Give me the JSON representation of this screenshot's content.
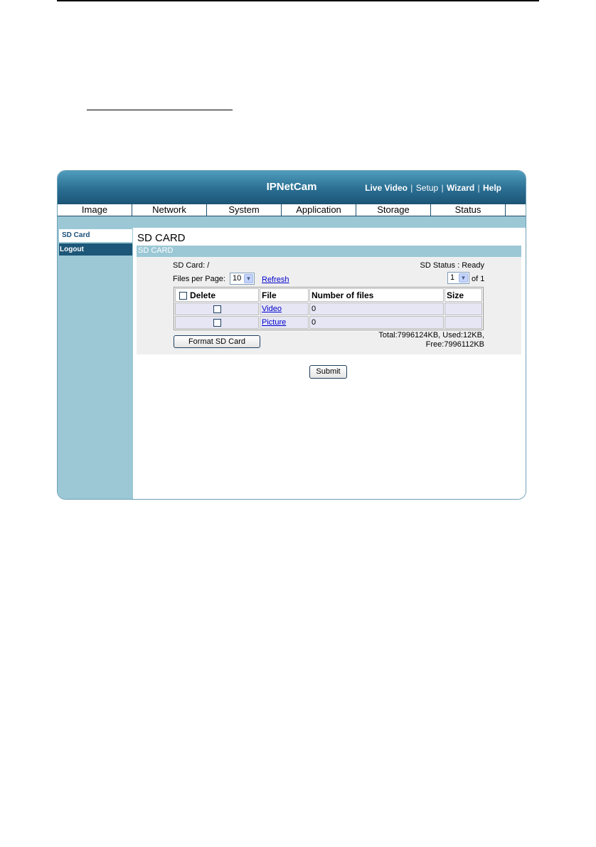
{
  "header": {
    "brand": "IPNetCam",
    "links": {
      "live_video": "Live Video",
      "setup": "Setup",
      "wizard": "Wizard",
      "help": "Help",
      "separator": "|"
    }
  },
  "menu": [
    {
      "label": "Image"
    },
    {
      "label": "Network"
    },
    {
      "label": "System"
    },
    {
      "label": "Application"
    },
    {
      "label": "Storage"
    },
    {
      "label": "Status"
    }
  ],
  "sidebar": {
    "items": [
      {
        "label": "SD Card",
        "active": true
      },
      {
        "label": "Logout",
        "active": false
      }
    ]
  },
  "page": {
    "title": "SD CARD",
    "section_title": "SD CARD",
    "sd_card_path": "SD Card: /",
    "sd_status": "SD Status : Ready",
    "files_per_page_label": "Files per Page:",
    "files_per_page_value": "10",
    "refresh_label": "Refresh",
    "page_value": "1",
    "of_pages": "of 1",
    "table": {
      "headers": [
        "Delete",
        "File",
        "Number of files",
        "Size"
      ],
      "rows": [
        {
          "file": "Video",
          "count": "0",
          "size": ""
        },
        {
          "file": "Picture",
          "count": "0",
          "size": ""
        }
      ]
    },
    "format_button": "Format SD Card",
    "usage_line1": "Total:7996124KB, Used:12KB,",
    "usage_line2": "Free:7996112KB",
    "submit_button": "Submit"
  },
  "colors": {
    "header_dark": "#1c5678",
    "header_light": "#4f9dbd",
    "panel_blue": "#9cc8d6",
    "link_blue": "#0000cc"
  }
}
